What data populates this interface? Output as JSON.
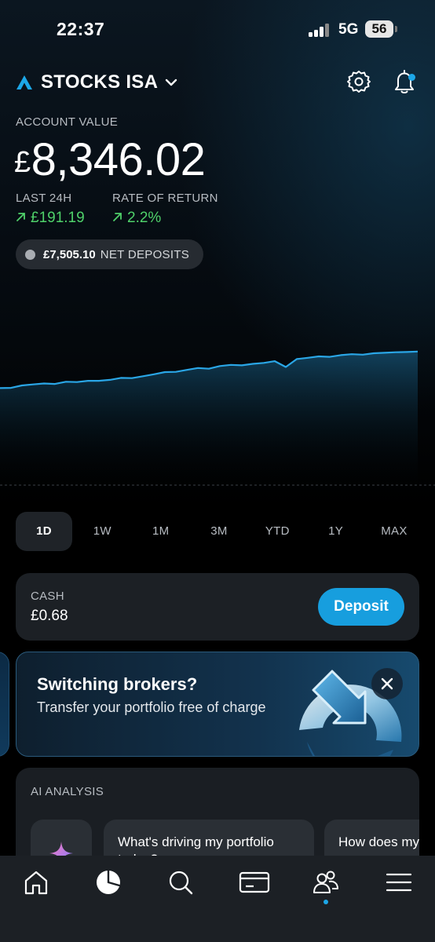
{
  "status_bar": {
    "time": "22:37",
    "network": "5G",
    "battery": "56"
  },
  "account": {
    "title": "STOCKS ISA"
  },
  "summary": {
    "value_label": "ACCOUNT VALUE",
    "currency": "£",
    "value": "8,346.02",
    "stat1_label": "LAST 24H",
    "stat1_value": "£191.19",
    "stat2_label": "RATE OF RETURN",
    "stat2_value": "2.2%",
    "deposits_amount": "£7,505.10",
    "deposits_label": "NET DEPOSITS"
  },
  "ranges": [
    "1D",
    "1W",
    "1M",
    "3M",
    "YTD",
    "1Y",
    "MAX"
  ],
  "active_range": "1D",
  "cash": {
    "label": "CASH",
    "value": "£0.68",
    "button": "Deposit"
  },
  "promo": {
    "title": "Switching brokers?",
    "subtitle": "Transfer your portfolio free of charge"
  },
  "ai": {
    "label": "AI ANALYSIS",
    "questions": [
      "What's driving my portfolio today?",
      "How does my compare to"
    ]
  },
  "colors": {
    "accent": "#1ca7e8",
    "positive": "#4fd16a",
    "line": "#2aa6e6"
  },
  "nav": [
    "home-icon",
    "portfolio-pie-icon",
    "search-icon",
    "card-icon",
    "community-icon",
    "menu-icon"
  ],
  "chart_data": {
    "type": "line",
    "series": [
      {
        "values": [
          8195,
          8196,
          8206,
          8210,
          8214,
          8212,
          8221,
          8220,
          8225,
          8225,
          8229,
          8237,
          8236,
          8244,
          8252,
          8261,
          8262,
          8270,
          8278,
          8275,
          8286,
          8291,
          8289,
          8295,
          8299,
          8306,
          8282,
          8315,
          8320,
          8326,
          8324,
          8331,
          8335,
          8333,
          8339,
          8341,
          8343,
          8344,
          8346
        ]
      }
    ],
    "xlabel": "",
    "ylabel": "",
    "grid": false
  }
}
